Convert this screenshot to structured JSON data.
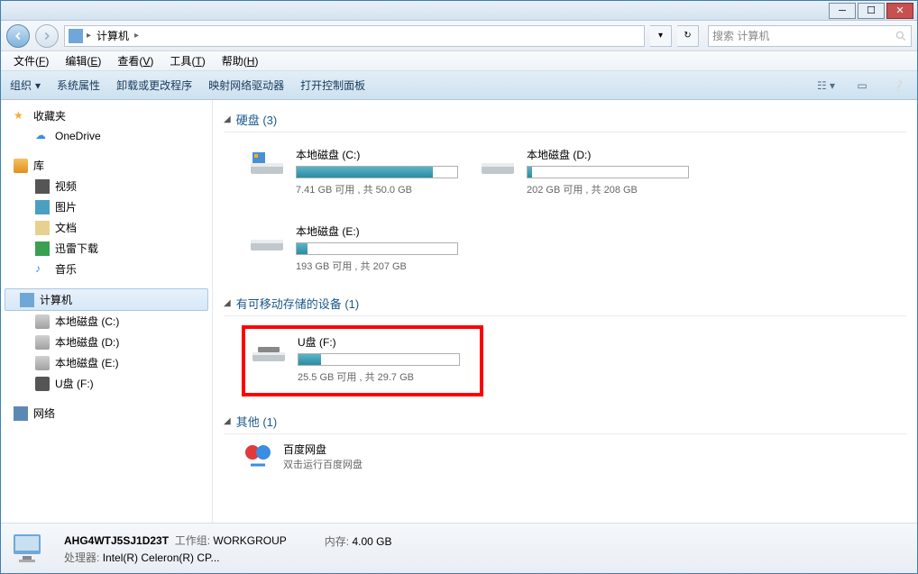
{
  "titlebar": {},
  "nav": {
    "crumb_computer": "计算机",
    "search_placeholder": "搜索 计算机"
  },
  "menus": [
    {
      "label": "文件",
      "key": "F"
    },
    {
      "label": "编辑",
      "key": "E"
    },
    {
      "label": "查看",
      "key": "V"
    },
    {
      "label": "工具",
      "key": "T"
    },
    {
      "label": "帮助",
      "key": "H"
    }
  ],
  "toolbar": {
    "organize": "组织",
    "sysprops": "系统属性",
    "uninstall": "卸载或更改程序",
    "mapdrive": "映射网络驱动器",
    "ctrlpanel": "打开控制面板"
  },
  "sidebar": {
    "favorites": "收藏夹",
    "onedrive": "OneDrive",
    "libraries": "库",
    "videos": "视频",
    "pictures": "图片",
    "documents": "文档",
    "xunlei": "迅雷下载",
    "music": "音乐",
    "computer": "计算机",
    "drive_c": "本地磁盘 (C:)",
    "drive_d": "本地磁盘 (D:)",
    "drive_e": "本地磁盘 (E:)",
    "drive_f": "U盘 (F:)",
    "network": "网络"
  },
  "sections": {
    "hdd": "硬盘 (3)",
    "removable": "有可移动存储的设备 (1)",
    "other": "其他 (1)"
  },
  "drives": {
    "c": {
      "name": "本地磁盘 (C:)",
      "stat": "7.41 GB 可用 , 共 50.0 GB",
      "pct": 85
    },
    "d": {
      "name": "本地磁盘 (D:)",
      "stat": "202 GB 可用 , 共 208 GB",
      "pct": 3
    },
    "e": {
      "name": "本地磁盘 (E:)",
      "stat": "193 GB 可用 , 共 207 GB",
      "pct": 7
    },
    "f": {
      "name": "U盘 (F:)",
      "stat": "25.5 GB 可用 , 共 29.7 GB",
      "pct": 14
    }
  },
  "other": {
    "baidu_name": "百度网盘",
    "baidu_sub": "双击运行百度网盘"
  },
  "status": {
    "name": "AHG4WTJ5SJ1D23T",
    "workgroup_label": "工作组:",
    "workgroup": "WORKGROUP",
    "cpu_label": "处理器:",
    "cpu": "Intel(R) Celeron(R) CP...",
    "mem_label": "内存:",
    "mem": "4.00 GB"
  }
}
